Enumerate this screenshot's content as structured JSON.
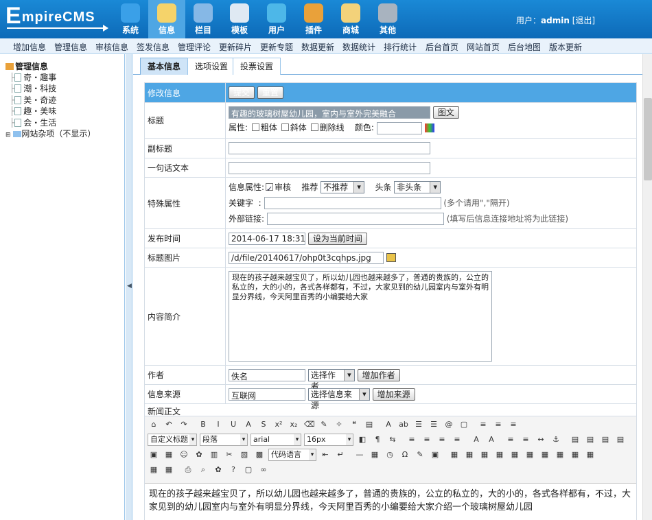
{
  "app": {
    "logo_first": "E",
    "logo_rest": "mpireCMS"
  },
  "nav": [
    {
      "label": "系统",
      "icon": "globe-icon",
      "color": "#3aa0e8"
    },
    {
      "label": "信息",
      "icon": "edit-icon",
      "color": "#f5d36a",
      "active": true
    },
    {
      "label": "栏目",
      "icon": "folder-icon",
      "color": "#86b8e6"
    },
    {
      "label": "模板",
      "icon": "window-icon",
      "color": "#dfe9f3"
    },
    {
      "label": "用户",
      "icon": "user-icon",
      "color": "#4db7e8"
    },
    {
      "label": "插件",
      "icon": "tools-icon",
      "color": "#e9a13a"
    },
    {
      "label": "商城",
      "icon": "card-icon",
      "color": "#f3d27a"
    },
    {
      "label": "其他",
      "icon": "gear-icon",
      "color": "#a8b3bf"
    }
  ],
  "user": {
    "prefix": "用户：",
    "name": "admin",
    "logout": "[退出]"
  },
  "menu": [
    "增加信息",
    "管理信息",
    "审核信息",
    "签发信息",
    "管理评论",
    "更新碎片",
    "更新专题",
    "数据更新",
    "数据统计",
    "排行统计",
    "后台首页",
    "网站首页",
    "后台地图",
    "版本更新"
  ],
  "tree": {
    "root": "管理信息",
    "items": [
      "奇・趣事",
      "潮・科技",
      "美・奇迹",
      "趣・美味",
      "会・生活"
    ],
    "other": "网站杂项（不显示）"
  },
  "tabs": [
    "基本信息",
    "选项设置",
    "投票设置"
  ],
  "form": {
    "header": {
      "label": "修改信息",
      "submit": "提交",
      "reset": "重置"
    },
    "title": {
      "label": "标题",
      "value": "有趣的玻璃树屋幼儿园，室内与室外完美融合",
      "pic_btn": "图文",
      "attr_label": "属性:",
      "bold": "粗体",
      "italic": "斜体",
      "strike": "删除线",
      "color_label": "颜色:"
    },
    "subtitle": {
      "label": "副标题"
    },
    "oneline": {
      "label": "一句话文本"
    },
    "special": {
      "label": "特殊属性",
      "info_attr": "信息属性:",
      "audit": "审核",
      "recommend": "推荐",
      "recommend_val": "不推荐",
      "headline": "头条",
      "headline_val": "非头条",
      "keyword": "关键字",
      "keyword_hint": "(多个请用\",\"隔开)",
      "external": "外部链接:",
      "external_hint": "(填写后信息连接地址将为此链接)"
    },
    "pubtime": {
      "label": "发布时间",
      "value": "2014-06-17 18:31:04",
      "btn": "设为当前时间"
    },
    "titlepic": {
      "label": "标题图片",
      "value": "/d/file/20140617/ohp0t3cqhps.jpg"
    },
    "summary": {
      "label": "内容简介",
      "value": "            现在的孩子越来越宝贝了，所以幼儿园也越来越多了，普通的贵族的，公立的私立的，大的小的，各式各样都有，不过，大家见到的幼儿园室内与室外有明显分界线，今天阿里百秀的小编要给大家"
    },
    "author": {
      "label": "作者",
      "value": "佚名",
      "select": "选择作者",
      "add": "增加作者"
    },
    "source": {
      "label": "信息来源",
      "value": "互联网",
      "select": "选择信息来源",
      "add": "增加来源"
    },
    "body": {
      "label": "新闻正文"
    }
  },
  "editor": {
    "style_sel": "自定义标题",
    "para_sel": "段落",
    "font_sel": "arial",
    "size_sel": "16px",
    "code_sel": "代码语言",
    "content": "现在的孩子越来越宝贝了，所以幼儿园也越来越多了，普通的贵族的，公立的私立的，大的小的，各式各样都有，不过，大家见到的幼儿园室内与室外有明显分界线，今天阿里百秀的小编要给大家介绍一个玻璃树屋幼儿园"
  }
}
